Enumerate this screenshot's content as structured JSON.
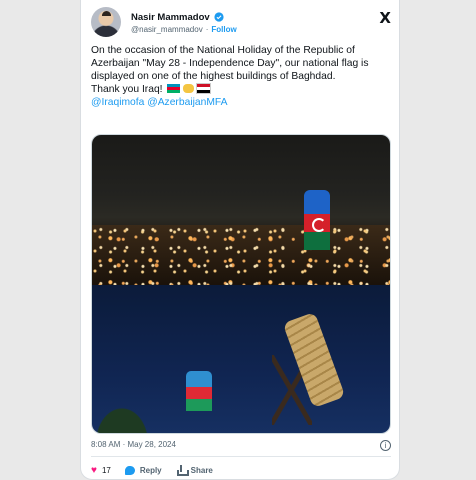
{
  "tweet": {
    "author_name": "Nasir Mammadov",
    "author_handle": "@nasir_mammadov",
    "separator": "·",
    "follow_label": "Follow",
    "text_line": "On the occasion of the National Holiday of the Republic of Azerbaijan \"May 28 - Independence Day\", our national flag is displayed on one of the highest buildings of Baghdad.",
    "thanks": "Thank you Iraq!",
    "mentions": "@Iraqimofa @AzerbaijanMFA",
    "timestamp": "8:08 AM · May 28, 2024",
    "likes": "17",
    "reply_label": "Reply",
    "share_label": "Share"
  },
  "icons": {
    "x_logo": "X",
    "info": "i",
    "heart": "♥"
  },
  "colors": {
    "accent": "#1d9bf0",
    "like": "#f91880",
    "text": "#0f1419",
    "muted": "#536471"
  }
}
